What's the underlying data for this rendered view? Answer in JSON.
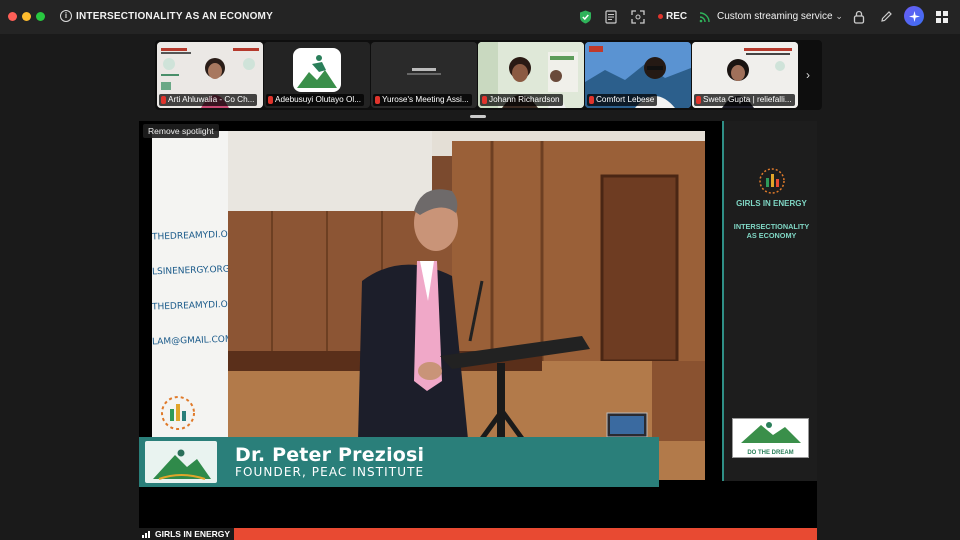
{
  "window": {
    "title": "INTERSECTIONALITY AS AN ECONOMY"
  },
  "toolbar": {
    "rec_label": "REC",
    "streaming_label": "Custom streaming service",
    "icons": [
      "shield-check-icon",
      "notes-icon",
      "fit-screen-icon",
      "streaming-icon",
      "lock-icon",
      "pencil-icon",
      "ai-sparkle-icon",
      "grid-view-icon"
    ]
  },
  "participants": [
    {
      "name": "Arti Ahluwalia - Co Ch..."
    },
    {
      "name": "Adebusuyi Olutayo Ol..."
    },
    {
      "name": "Yurose's Meeting Assi..."
    },
    {
      "name": "Johann Richardson"
    },
    {
      "name": "Comfort Lebese"
    },
    {
      "name": "Sweta Gupta | reliefalli..."
    }
  ],
  "stage": {
    "remove_spotlight": "Remove spotlight",
    "banner_lines": [
      "THEDREAMYDI.ORG",
      "LSINENERGY.ORG",
      "THEDREAMYDI.ORG",
      "LAM@GMAIL.COM"
    ],
    "right_panel": {
      "title": "GIRLS IN ENERGY",
      "subtitle_line1": "INTERSECTIONALITY",
      "subtitle_line2": "AS ECONOMY",
      "logo_text": "DO THE DREAM"
    },
    "lower_third": {
      "name": "Dr. Peter Preziosi",
      "role": "FOUNDER, PEAC INSTITUTE"
    },
    "ticker_label": "GIRLS IN ENERGY"
  },
  "colors": {
    "teal": "#2a7f7a",
    "ticker_red": "#e84a32",
    "rec_red": "#e0342c",
    "accent_purple": "#6b5cf5"
  }
}
